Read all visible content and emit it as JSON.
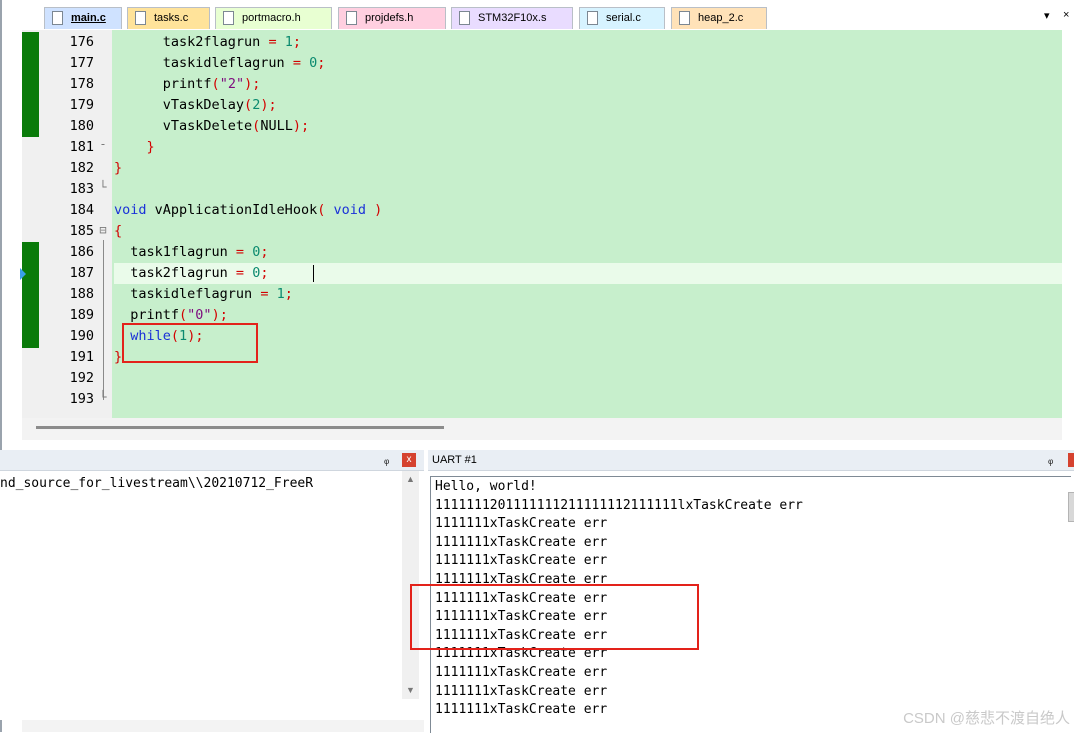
{
  "tabs": [
    {
      "label": "main.c",
      "color": "#cfe2ff"
    },
    {
      "label": "tasks.c",
      "color": "#ffe39a"
    },
    {
      "label": "portmacro.h",
      "color": "#e8ffd2"
    },
    {
      "label": "projdefs.h",
      "color": "#ffcfe0"
    },
    {
      "label": "STM32F10x.s",
      "color": "#e9dcff"
    },
    {
      "label": "serial.c",
      "color": "#d7f3ff"
    },
    {
      "label": "heap_2.c",
      "color": "#ffe2b8"
    }
  ],
  "tab_controls": {
    "dropdown": "▾",
    "close": "×"
  },
  "editor": {
    "line_numbers": [
      "176",
      "177",
      "178",
      "179",
      "180",
      "181",
      "182",
      "183",
      "184",
      "185",
      "186",
      "187",
      "188",
      "189",
      "190",
      "191",
      "192",
      "193"
    ],
    "current_line_index": 11
  },
  "left_pane": {
    "path_text": "nd_source_for_livestream\\\\20210712_FreeR",
    "pin": "ᵠ",
    "close": "x"
  },
  "uart": {
    "title": "UART #1",
    "pin": "ᵠ",
    "lines": [
      "Hello, world!",
      "1111111201111111211111112111111lxTaskCreate err",
      "1111111xTaskCreate err",
      "1111111xTaskCreate err",
      "1111111xTaskCreate err",
      "1111111xTaskCreate err",
      "1111111xTaskCreate err",
      "1111111xTaskCreate err",
      "1111111xTaskCreate err",
      "1111111xTaskCreate err",
      "1111111xTaskCreate err",
      "1111111xTaskCreate err",
      "1111111xTaskCreate err"
    ]
  },
  "watermark": "CSDN @慈悲不渡自绝人"
}
